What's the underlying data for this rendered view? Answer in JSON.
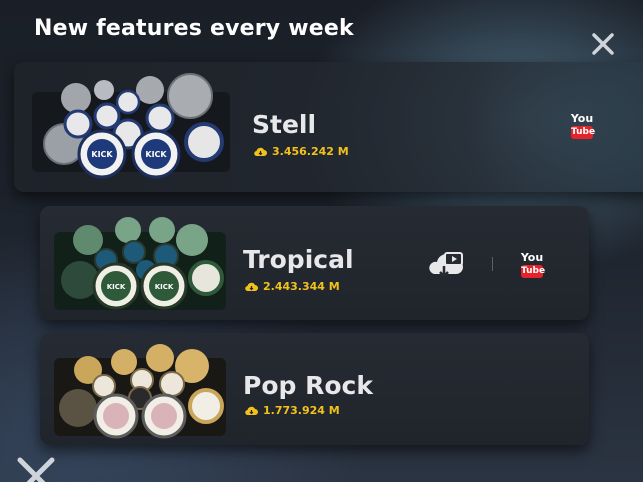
{
  "header": {
    "title": "New features every week"
  },
  "kits": [
    {
      "name": "Stell",
      "downloads": "3.456.242 M",
      "kick_label": "KICK",
      "youtube_you": "You",
      "youtube_tube": "Tube"
    },
    {
      "name": "Tropical",
      "downloads": "2.443.344 M",
      "kick_label": "KICK",
      "youtube_you": "You",
      "youtube_tube": "Tube"
    },
    {
      "name": "Pop Rock",
      "downloads": "1.773.924 M"
    }
  ],
  "colors": {
    "accent": "#f2c21b",
    "youtube_red": "#e4232b",
    "card_bg": "#22262d"
  },
  "icons": [
    "close-icon",
    "cloud-download-icon",
    "youtube-icon",
    "cloud-video-icon"
  ]
}
